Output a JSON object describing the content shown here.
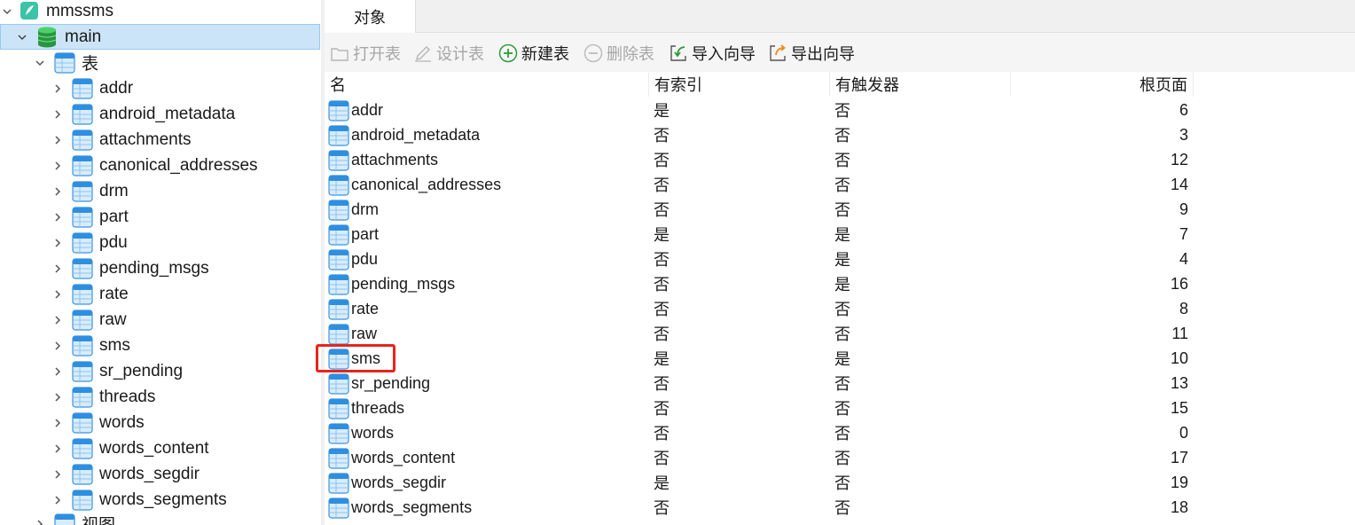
{
  "tree": {
    "db_label": "mmssms",
    "schema_label": "main",
    "tables_group_label": "表",
    "tables": [
      "addr",
      "android_metadata",
      "attachments",
      "canonical_addresses",
      "drm",
      "part",
      "pdu",
      "pending_msgs",
      "rate",
      "raw",
      "sms",
      "sr_pending",
      "threads",
      "words",
      "words_content",
      "words_segdir",
      "words_segments"
    ],
    "views_group_label": "视图"
  },
  "tabs": [
    {
      "label": "对象"
    }
  ],
  "toolbar": {
    "open_table": "打开表",
    "design_table": "设计表",
    "new_table": "新建表",
    "delete_table": "删除表",
    "import_wizard": "导入向导",
    "export_wizard": "导出向导"
  },
  "table": {
    "columns": [
      "名",
      "有索引",
      "有触发器",
      "根页面"
    ],
    "rows": [
      {
        "name": "addr",
        "has_index": "是",
        "has_trigger": "否",
        "root_page": "6"
      },
      {
        "name": "android_metadata",
        "has_index": "否",
        "has_trigger": "否",
        "root_page": "3"
      },
      {
        "name": "attachments",
        "has_index": "否",
        "has_trigger": "否",
        "root_page": "12"
      },
      {
        "name": "canonical_addresses",
        "has_index": "否",
        "has_trigger": "否",
        "root_page": "14"
      },
      {
        "name": "drm",
        "has_index": "否",
        "has_trigger": "否",
        "root_page": "9"
      },
      {
        "name": "part",
        "has_index": "是",
        "has_trigger": "是",
        "root_page": "7"
      },
      {
        "name": "pdu",
        "has_index": "否",
        "has_trigger": "是",
        "root_page": "4"
      },
      {
        "name": "pending_msgs",
        "has_index": "否",
        "has_trigger": "是",
        "root_page": "16"
      },
      {
        "name": "rate",
        "has_index": "否",
        "has_trigger": "否",
        "root_page": "8"
      },
      {
        "name": "raw",
        "has_index": "否",
        "has_trigger": "否",
        "root_page": "11"
      },
      {
        "name": "sms",
        "has_index": "是",
        "has_trigger": "是",
        "root_page": "10"
      },
      {
        "name": "sr_pending",
        "has_index": "否",
        "has_trigger": "否",
        "root_page": "13"
      },
      {
        "name": "threads",
        "has_index": "否",
        "has_trigger": "否",
        "root_page": "15"
      },
      {
        "name": "words",
        "has_index": "否",
        "has_trigger": "否",
        "root_page": "0"
      },
      {
        "name": "words_content",
        "has_index": "否",
        "has_trigger": "否",
        "root_page": "17"
      },
      {
        "name": "words_segdir",
        "has_index": "是",
        "has_trigger": "否",
        "root_page": "19"
      },
      {
        "name": "words_segments",
        "has_index": "否",
        "has_trigger": "否",
        "root_page": "18"
      }
    ],
    "highlighted_row": "sms"
  },
  "colors": {
    "selection_bg": "#cce4f7",
    "highlight_border": "#e8241c",
    "table_icon_blue": "#2e8fe0",
    "db_icon_green": "#2aa84a"
  }
}
